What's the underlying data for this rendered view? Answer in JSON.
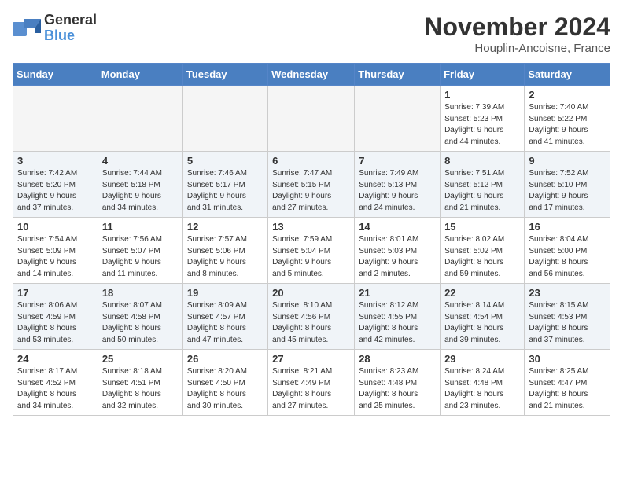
{
  "header": {
    "logo_line1": "General",
    "logo_line2": "Blue",
    "month_title": "November 2024",
    "subtitle": "Houplin-Ancoisne, France"
  },
  "weekdays": [
    "Sunday",
    "Monday",
    "Tuesday",
    "Wednesday",
    "Thursday",
    "Friday",
    "Saturday"
  ],
  "weeks": [
    [
      {
        "day": "",
        "info": ""
      },
      {
        "day": "",
        "info": ""
      },
      {
        "day": "",
        "info": ""
      },
      {
        "day": "",
        "info": ""
      },
      {
        "day": "",
        "info": ""
      },
      {
        "day": "1",
        "info": "Sunrise: 7:39 AM\nSunset: 5:23 PM\nDaylight: 9 hours\nand 44 minutes."
      },
      {
        "day": "2",
        "info": "Sunrise: 7:40 AM\nSunset: 5:22 PM\nDaylight: 9 hours\nand 41 minutes."
      }
    ],
    [
      {
        "day": "3",
        "info": "Sunrise: 7:42 AM\nSunset: 5:20 PM\nDaylight: 9 hours\nand 37 minutes."
      },
      {
        "day": "4",
        "info": "Sunrise: 7:44 AM\nSunset: 5:18 PM\nDaylight: 9 hours\nand 34 minutes."
      },
      {
        "day": "5",
        "info": "Sunrise: 7:46 AM\nSunset: 5:17 PM\nDaylight: 9 hours\nand 31 minutes."
      },
      {
        "day": "6",
        "info": "Sunrise: 7:47 AM\nSunset: 5:15 PM\nDaylight: 9 hours\nand 27 minutes."
      },
      {
        "day": "7",
        "info": "Sunrise: 7:49 AM\nSunset: 5:13 PM\nDaylight: 9 hours\nand 24 minutes."
      },
      {
        "day": "8",
        "info": "Sunrise: 7:51 AM\nSunset: 5:12 PM\nDaylight: 9 hours\nand 21 minutes."
      },
      {
        "day": "9",
        "info": "Sunrise: 7:52 AM\nSunset: 5:10 PM\nDaylight: 9 hours\nand 17 minutes."
      }
    ],
    [
      {
        "day": "10",
        "info": "Sunrise: 7:54 AM\nSunset: 5:09 PM\nDaylight: 9 hours\nand 14 minutes."
      },
      {
        "day": "11",
        "info": "Sunrise: 7:56 AM\nSunset: 5:07 PM\nDaylight: 9 hours\nand 11 minutes."
      },
      {
        "day": "12",
        "info": "Sunrise: 7:57 AM\nSunset: 5:06 PM\nDaylight: 9 hours\nand 8 minutes."
      },
      {
        "day": "13",
        "info": "Sunrise: 7:59 AM\nSunset: 5:04 PM\nDaylight: 9 hours\nand 5 minutes."
      },
      {
        "day": "14",
        "info": "Sunrise: 8:01 AM\nSunset: 5:03 PM\nDaylight: 9 hours\nand 2 minutes."
      },
      {
        "day": "15",
        "info": "Sunrise: 8:02 AM\nSunset: 5:02 PM\nDaylight: 8 hours\nand 59 minutes."
      },
      {
        "day": "16",
        "info": "Sunrise: 8:04 AM\nSunset: 5:00 PM\nDaylight: 8 hours\nand 56 minutes."
      }
    ],
    [
      {
        "day": "17",
        "info": "Sunrise: 8:06 AM\nSunset: 4:59 PM\nDaylight: 8 hours\nand 53 minutes."
      },
      {
        "day": "18",
        "info": "Sunrise: 8:07 AM\nSunset: 4:58 PM\nDaylight: 8 hours\nand 50 minutes."
      },
      {
        "day": "19",
        "info": "Sunrise: 8:09 AM\nSunset: 4:57 PM\nDaylight: 8 hours\nand 47 minutes."
      },
      {
        "day": "20",
        "info": "Sunrise: 8:10 AM\nSunset: 4:56 PM\nDaylight: 8 hours\nand 45 minutes."
      },
      {
        "day": "21",
        "info": "Sunrise: 8:12 AM\nSunset: 4:55 PM\nDaylight: 8 hours\nand 42 minutes."
      },
      {
        "day": "22",
        "info": "Sunrise: 8:14 AM\nSunset: 4:54 PM\nDaylight: 8 hours\nand 39 minutes."
      },
      {
        "day": "23",
        "info": "Sunrise: 8:15 AM\nSunset: 4:53 PM\nDaylight: 8 hours\nand 37 minutes."
      }
    ],
    [
      {
        "day": "24",
        "info": "Sunrise: 8:17 AM\nSunset: 4:52 PM\nDaylight: 8 hours\nand 34 minutes."
      },
      {
        "day": "25",
        "info": "Sunrise: 8:18 AM\nSunset: 4:51 PM\nDaylight: 8 hours\nand 32 minutes."
      },
      {
        "day": "26",
        "info": "Sunrise: 8:20 AM\nSunset: 4:50 PM\nDaylight: 8 hours\nand 30 minutes."
      },
      {
        "day": "27",
        "info": "Sunrise: 8:21 AM\nSunset: 4:49 PM\nDaylight: 8 hours\nand 27 minutes."
      },
      {
        "day": "28",
        "info": "Sunrise: 8:23 AM\nSunset: 4:48 PM\nDaylight: 8 hours\nand 25 minutes."
      },
      {
        "day": "29",
        "info": "Sunrise: 8:24 AM\nSunset: 4:48 PM\nDaylight: 8 hours\nand 23 minutes."
      },
      {
        "day": "30",
        "info": "Sunrise: 8:25 AM\nSunset: 4:47 PM\nDaylight: 8 hours\nand 21 minutes."
      }
    ]
  ]
}
